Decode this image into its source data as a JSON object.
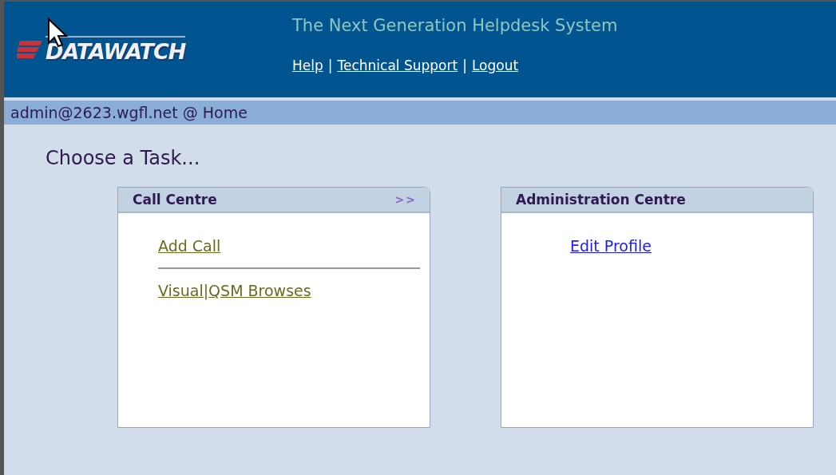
{
  "header": {
    "logo": "DATAWATCH",
    "tagline": "The Next Generation Helpdesk System",
    "links": [
      {
        "label": "Help"
      },
      {
        "label": "Technical Support"
      },
      {
        "label": "Logout"
      }
    ],
    "link_separator": "|"
  },
  "breadcrumb": "admin@2623.wgfl.net @ Home",
  "heading": "Choose a Task...",
  "panels": [
    {
      "title": "Call Centre",
      "expand": ">>",
      "items": [
        {
          "kind": "link",
          "label": "Add Call",
          "visited": true
        },
        {
          "kind": "rule"
        },
        {
          "kind": "link",
          "label": "Visual|QSM Browses",
          "visited": true
        }
      ]
    },
    {
      "title": "Administration Centre",
      "items": [
        {
          "kind": "link",
          "label": "Edit Profile",
          "visited": false
        }
      ]
    }
  ]
}
